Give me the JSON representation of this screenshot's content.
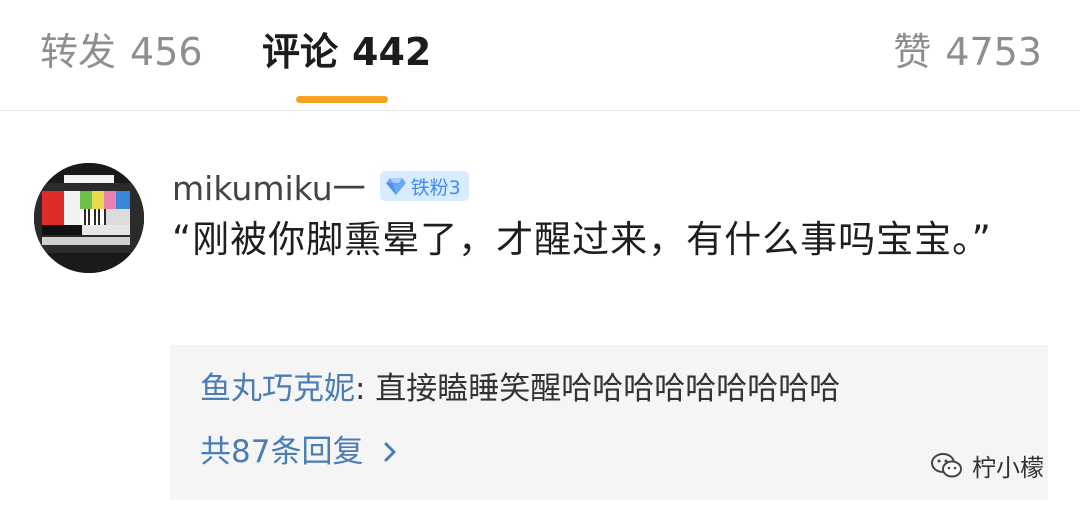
{
  "tabs": {
    "repost": {
      "label": "转发",
      "count": "456"
    },
    "comments": {
      "label": "评论",
      "count": "442"
    },
    "likes": {
      "label": "赞",
      "count": "4753"
    }
  },
  "comment": {
    "username": "mikumiku一",
    "badge": "铁粉3",
    "text": "“刚被你脚熏晕了，才醒过来，有什么事吗宝宝。”",
    "reply": {
      "author": "鱼丸巧克妮",
      "text": ": 直接瞌睡笑醒哈哈哈哈哈哈哈哈哈",
      "total": "共87条回复"
    }
  },
  "watermark": "柠小檬",
  "colors": {
    "accent": "#f7a224",
    "link": "#4a7cb6",
    "badge_bg": "#d9ecff",
    "badge_text": "#3d8cf0"
  }
}
